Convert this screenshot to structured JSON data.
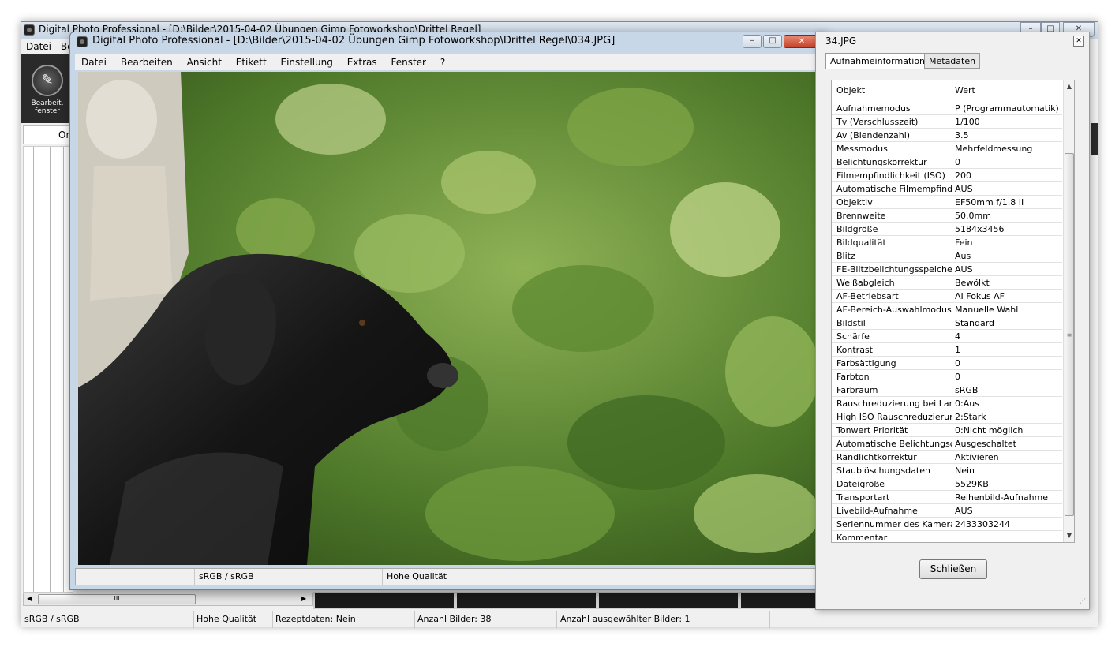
{
  "back_window": {
    "title": "Digital Photo Professional - [D:\\Bilder\\2015-04-02 Übungen  Gimp Fotoworkshop\\Drittel Regel]",
    "menu": [
      "Datei",
      "Be"
    ],
    "toolbar_label": "Bearbeit.\nfenster",
    "left_tab": "Or",
    "scroll_thumb": "III",
    "status": {
      "color_space": "sRGB / sRGB",
      "quality": "Hohe Qualität",
      "recipe": "Rezeptdaten: Nein",
      "count": "Anzahl Bilder: 38",
      "selected": "Anzahl ausgewählter Bilder: 1"
    },
    "caption_buttons": {
      "min": "–",
      "max": "□",
      "close": "✕"
    }
  },
  "image_window": {
    "title": "Digital Photo Professional - [D:\\Bilder\\2015-04-02 Übungen  Gimp Fotoworkshop\\Drittel Regel\\034.JPG]",
    "menu": [
      "Datei",
      "Bearbeiten",
      "Ansicht",
      "Etikett",
      "Einstellung",
      "Extras",
      "Fenster",
      "?"
    ],
    "status_color_space": "sRGB / sRGB",
    "status_quality": "Hohe Qualität",
    "caption_buttons": {
      "min": "–",
      "max": "□",
      "close": "✕"
    }
  },
  "info_panel": {
    "title": "34.JPG",
    "close": "✕",
    "tabs": [
      "Aufnahmeinformationen",
      "Metadaten"
    ],
    "header": {
      "col1": "Objekt",
      "col2": "Wert"
    },
    "rows": [
      [
        "Aufnahmemodus",
        "P (Programmautomatik)"
      ],
      [
        "Tv (Verschlusszeit)",
        "1/100"
      ],
      [
        "Av (Blendenzahl)",
        "3.5"
      ],
      [
        "Messmodus",
        "Mehrfeldmessung"
      ],
      [
        "Belichtungskorrektur",
        "0"
      ],
      [
        "Filmempfindlichkeit (ISO)",
        "200"
      ],
      [
        "Automatische Filmempfindli...",
        "AUS"
      ],
      [
        "Objektiv",
        "EF50mm f/1.8 II"
      ],
      [
        "Brennweite",
        "50.0mm"
      ],
      [
        "Bildgröße",
        "5184x3456"
      ],
      [
        "Bildqualität",
        "Fein"
      ],
      [
        "Blitz",
        "Aus"
      ],
      [
        "FE-Blitzbelichtungsspeicher...",
        "AUS"
      ],
      [
        "Weißabgleich",
        "Bewölkt"
      ],
      [
        "AF-Betriebsart",
        "AI Fokus AF"
      ],
      [
        "AF-Bereich-Auswahlmodus",
        "Manuelle  Wahl"
      ],
      [
        "Bildstil",
        "Standard"
      ],
      [
        "Schärfe",
        "4"
      ],
      [
        "Kontrast",
        "1"
      ],
      [
        "Farbsättigung",
        "0"
      ],
      [
        "Farbton",
        "0"
      ],
      [
        "Farbraum",
        "sRGB"
      ],
      [
        "Rauschreduzierung bei Lan...",
        "0:Aus"
      ],
      [
        "High ISO Rauschreduzierung",
        "2:Stark"
      ],
      [
        "Tonwert Priorität",
        "0:Nicht möglich"
      ],
      [
        "Automatische Belichtungso...",
        "Ausgeschaltet"
      ],
      [
        "Randlichtkorrektur",
        "Aktivieren"
      ],
      [
        "Staublöschungsdaten",
        "Nein"
      ],
      [
        "Dateigröße",
        "5529KB"
      ],
      [
        "Transportart",
        "Reihenbild-Aufnahme"
      ],
      [
        "Livebild-Aufnahme",
        "AUS"
      ],
      [
        "Seriennummer des Kamera...",
        "2433303244"
      ],
      [
        "Kommentar",
        ""
      ]
    ],
    "scroll_grip": "≡",
    "close_button": "Schließen"
  }
}
